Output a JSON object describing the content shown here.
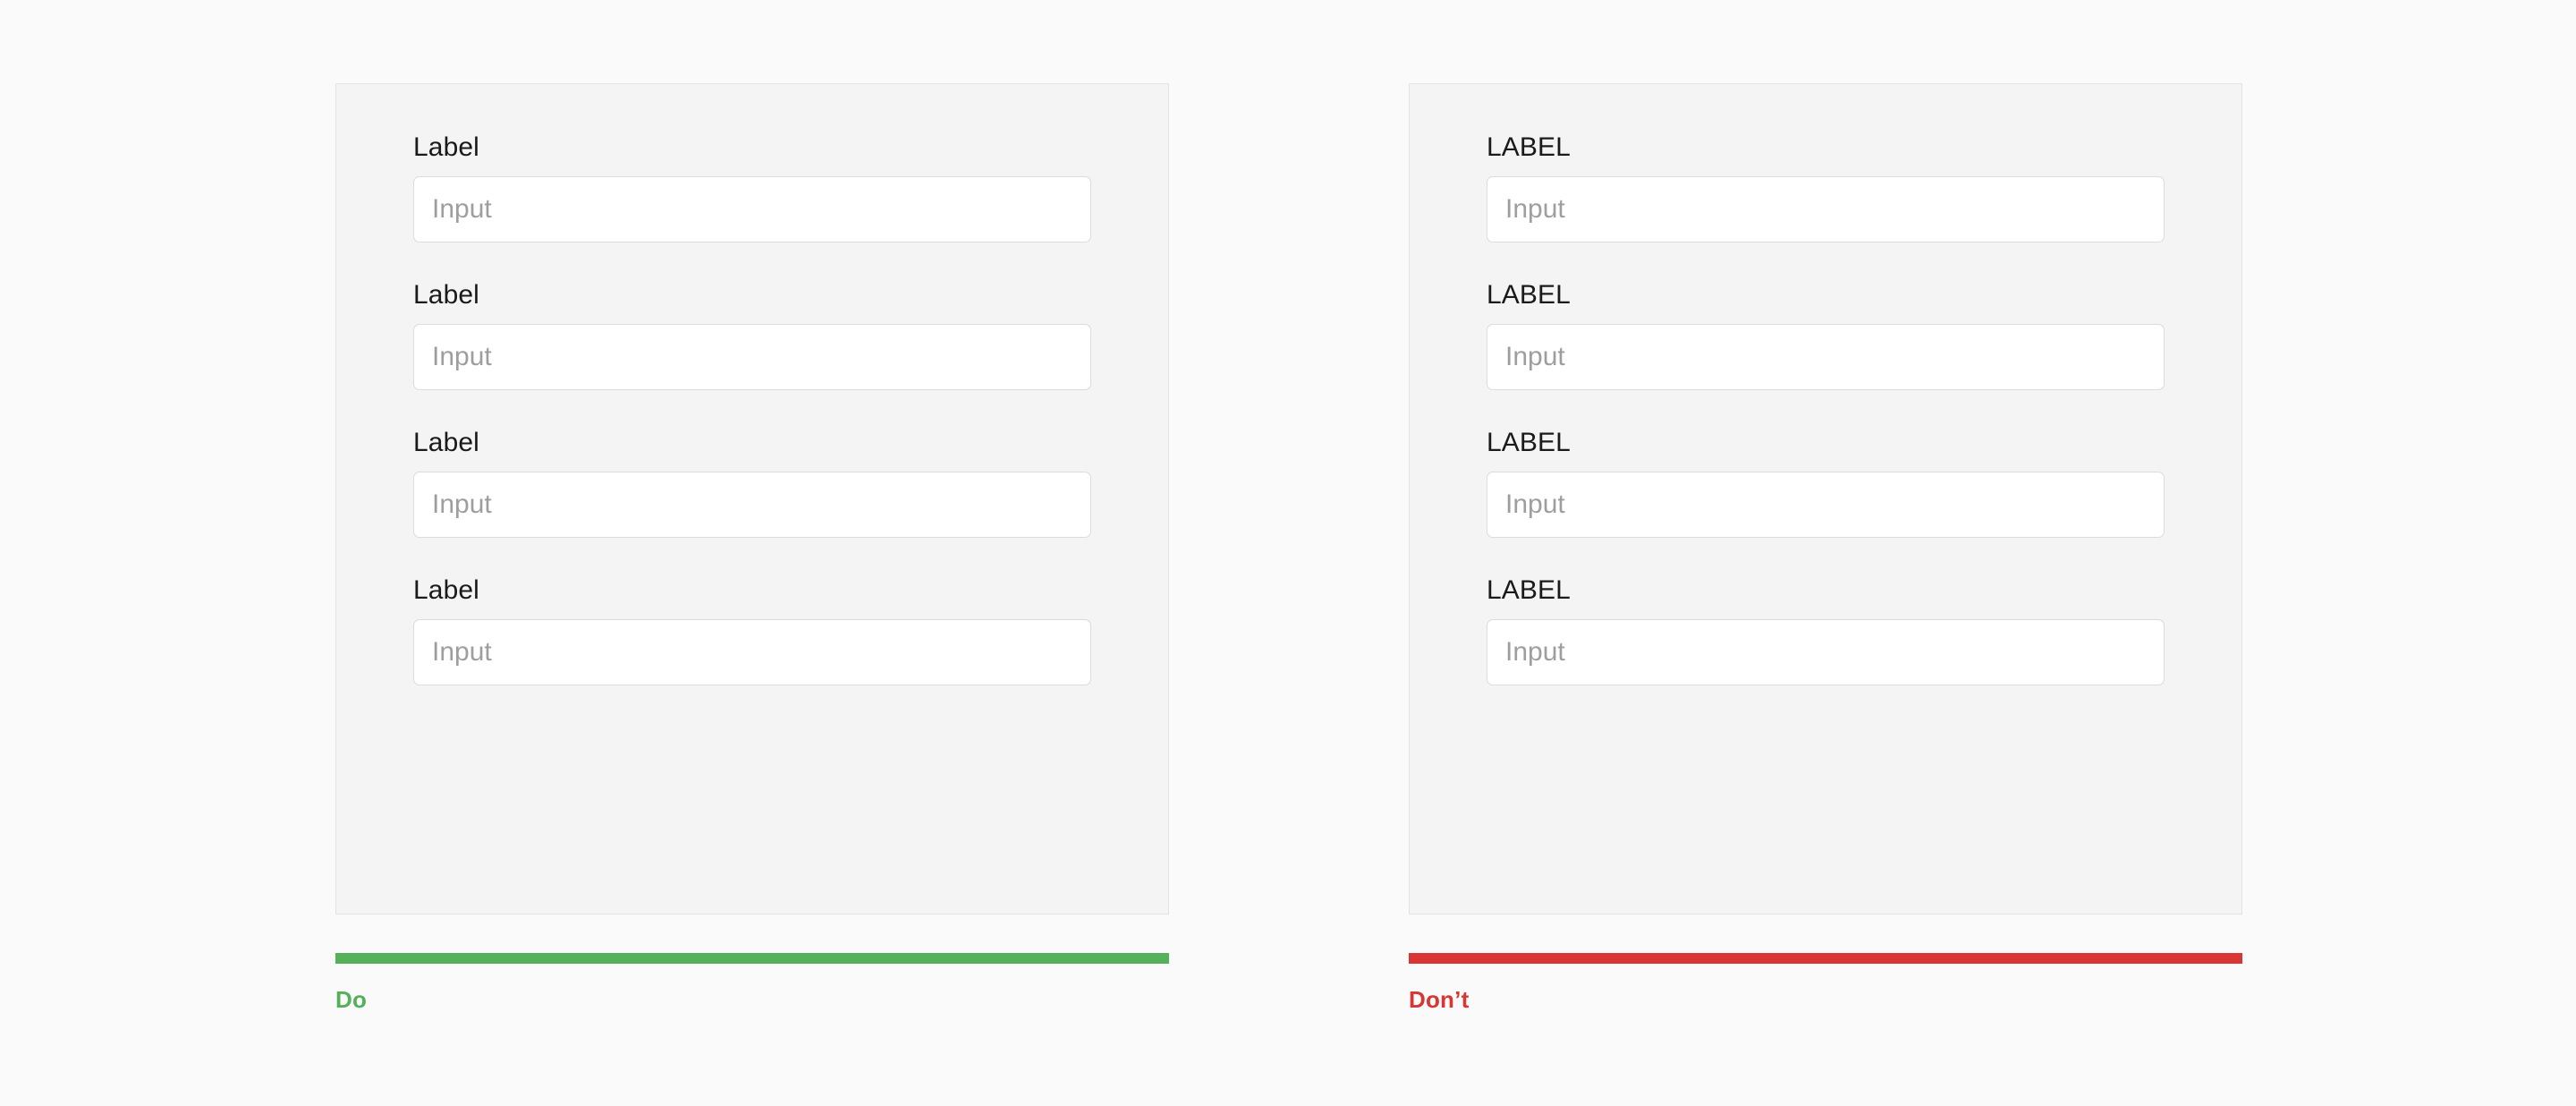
{
  "theme": {
    "page_background": "#fafafa",
    "panel_background": "#f4f4f4",
    "panel_border": "#e3e3e3",
    "input_background": "#ffffff",
    "input_border": "#dcdcdc",
    "placeholder_color": "#9e9e9e",
    "label_color": "#1a1a1a",
    "do_color": "#54b159",
    "dont_color": "#d83534"
  },
  "examples": [
    {
      "id": "do",
      "verdict_label": "Do",
      "verdict_color": "#54b159",
      "fields": [
        {
          "label": "Label",
          "value": "",
          "placeholder": "Input"
        },
        {
          "label": "Label",
          "value": "",
          "placeholder": "Input"
        },
        {
          "label": "Label",
          "value": "",
          "placeholder": "Input"
        },
        {
          "label": "Label",
          "value": "",
          "placeholder": "Input"
        }
      ]
    },
    {
      "id": "dont",
      "verdict_label": "Don’t",
      "verdict_color": "#d83534",
      "fields": [
        {
          "label": "LABEL",
          "value": "",
          "placeholder": "Input"
        },
        {
          "label": "LABEL",
          "value": "",
          "placeholder": "Input"
        },
        {
          "label": "LABEL",
          "value": "",
          "placeholder": "Input"
        },
        {
          "label": "LABEL",
          "value": "",
          "placeholder": "Input"
        }
      ]
    }
  ]
}
